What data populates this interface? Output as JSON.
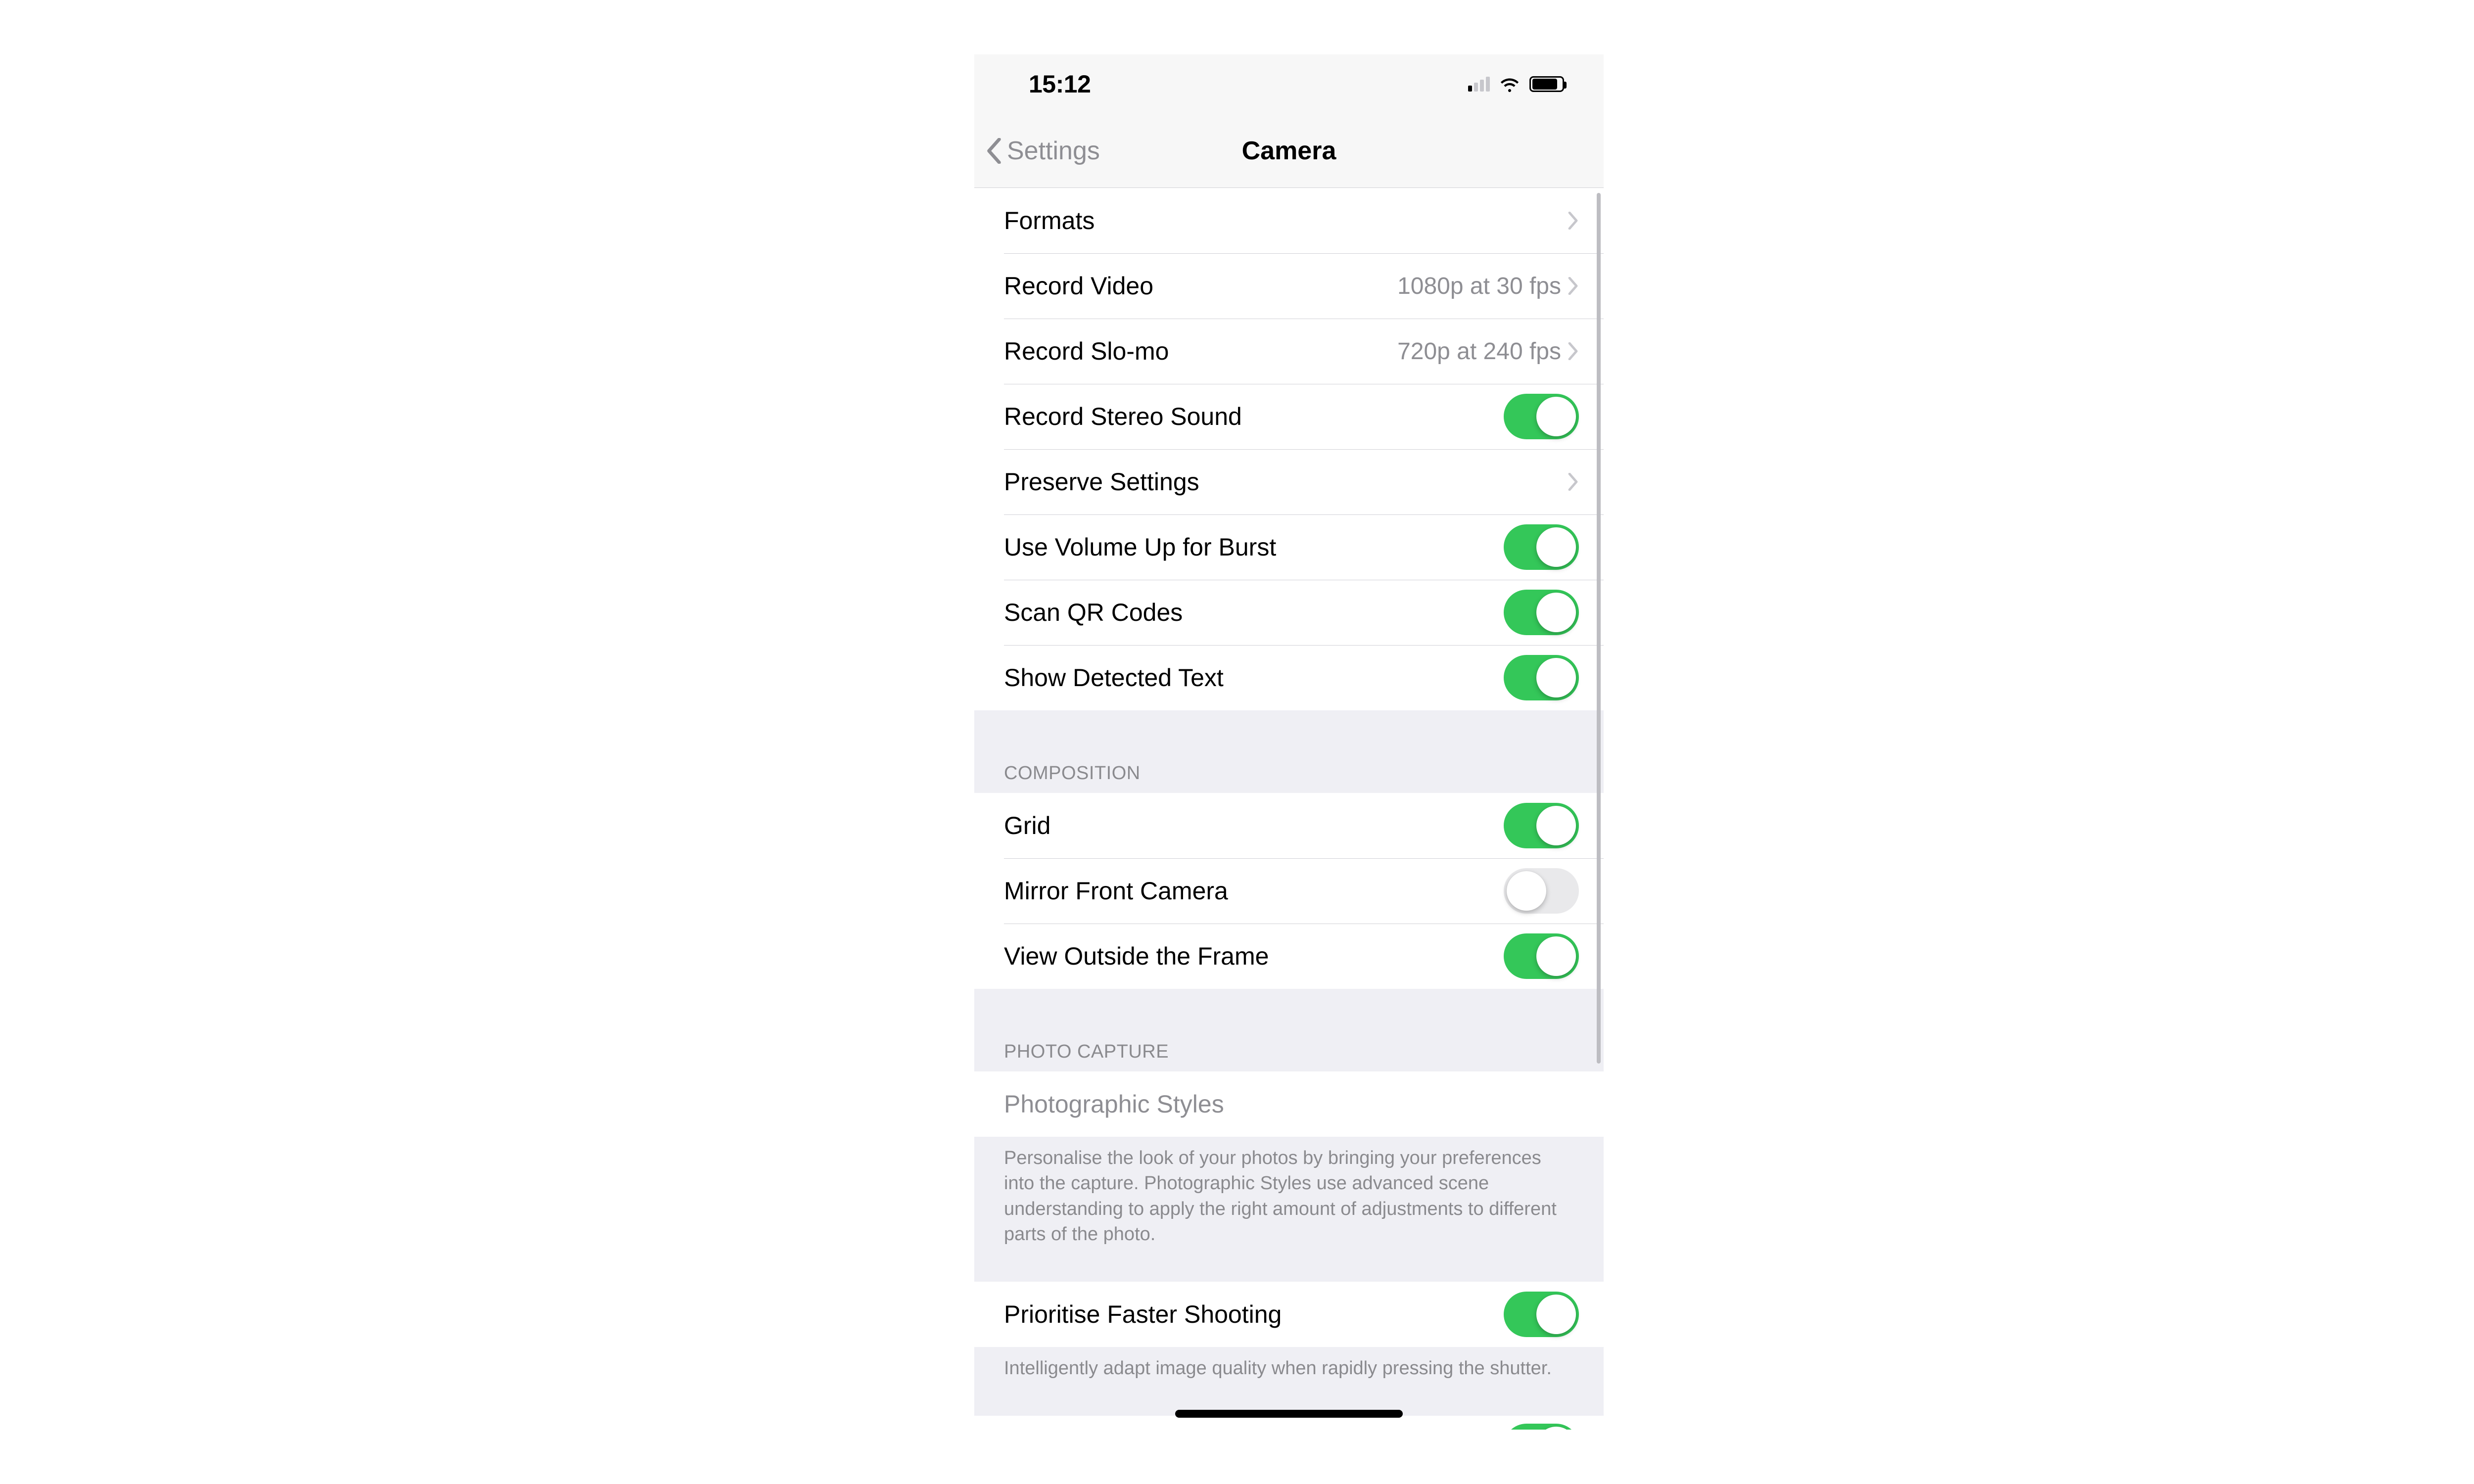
{
  "status": {
    "time": "15:12",
    "cell_active_bars": 1,
    "battery_pct": 80
  },
  "nav": {
    "back_label": "Settings",
    "title": "Camera"
  },
  "group1": {
    "rows": {
      "formats": {
        "label": "Formats"
      },
      "record_video": {
        "label": "Record Video",
        "detail": "1080p at 30 fps"
      },
      "record_slomo": {
        "label": "Record Slo-mo",
        "detail": "720p at 240 fps"
      },
      "record_stereo": {
        "label": "Record Stereo Sound",
        "on": true
      },
      "preserve": {
        "label": "Preserve Settings"
      },
      "volume_burst": {
        "label": "Use Volume Up for Burst",
        "on": true
      },
      "scan_qr": {
        "label": "Scan QR Codes",
        "on": true
      },
      "detected_text": {
        "label": "Show Detected Text",
        "on": true
      }
    }
  },
  "composition": {
    "header": "COMPOSITION",
    "rows": {
      "grid": {
        "label": "Grid",
        "on": true
      },
      "mirror": {
        "label": "Mirror Front Camera",
        "on": false
      },
      "outside_frame": {
        "label": "View Outside the Frame",
        "on": true
      }
    }
  },
  "photo_capture": {
    "header": "PHOTO CAPTURE",
    "styles": {
      "label": "Photographic Styles"
    },
    "styles_footer": "Personalise the look of your photos by bringing your preferences into the capture. Photographic Styles use advanced scene understanding to apply the right amount of adjustments to different parts of the photo.",
    "faster": {
      "label": "Prioritise Faster Shooting",
      "on": true
    },
    "faster_footer": "Intelligently adapt image quality when rapidly pressing the shutter.",
    "lens": {
      "label": "",
      "on": true
    }
  }
}
